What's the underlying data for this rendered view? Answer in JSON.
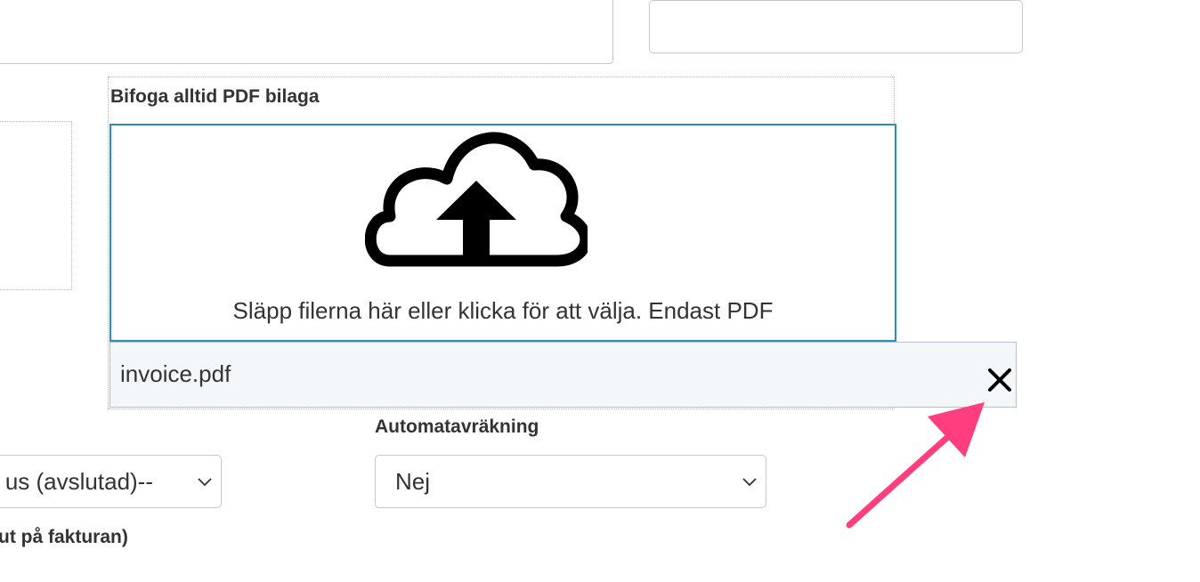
{
  "form": {
    "attachment_label": "Bifoga alltid PDF bilaga",
    "dropzone_text": "Släpp filerna här eller klicka för att välja. Endast PDF",
    "uploaded_file": "invoice.pdf",
    "auto_settlement_label": "Automatavräkning",
    "status_select_value": "us (avslutad)--",
    "auto_settlement_value": "Nej",
    "bottom_label": "ut på fakturan)"
  },
  "icons": {
    "upload": "cloud-upload-icon",
    "remove": "close-icon",
    "dropdown": "chevron-down-icon"
  },
  "colors": {
    "dropzone_border": "#2a8fbd",
    "file_row_bg": "#f4f7fa",
    "annotation_arrow": "#ff3d7f"
  }
}
